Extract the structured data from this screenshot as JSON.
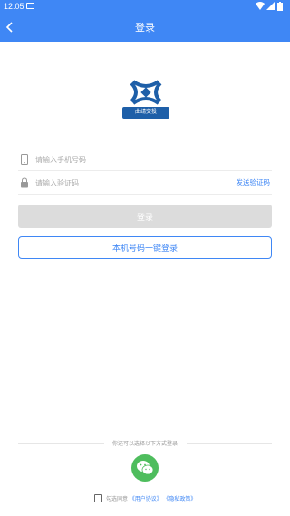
{
  "status_bar": {
    "time": "12:05"
  },
  "nav": {
    "title": "登录",
    "back_icon": "chevron-left-icon"
  },
  "logo": {
    "text": "曲靖交投",
    "color": "#1e5fa8"
  },
  "form": {
    "phone_placeholder": "请输入手机号码",
    "code_placeholder": "请输入验证码",
    "send_code_label": "发送验证码",
    "phone_icon": "phone-icon",
    "lock_icon": "lock-icon"
  },
  "buttons": {
    "login_label": "登录",
    "onekey_label": "本机号码一键登录"
  },
  "alt_login": {
    "divider_text": "你还可以选择以下方式登录",
    "wechat_icon": "wechat-icon"
  },
  "agreement": {
    "prefix": "勾选同意",
    "user_agreement": "《用户协议》",
    "privacy_policy": "《隐私政策》"
  },
  "colors": {
    "primary": "#3f87f5",
    "wechat": "#4ebd5d",
    "disabled": "#dcdcdc"
  }
}
